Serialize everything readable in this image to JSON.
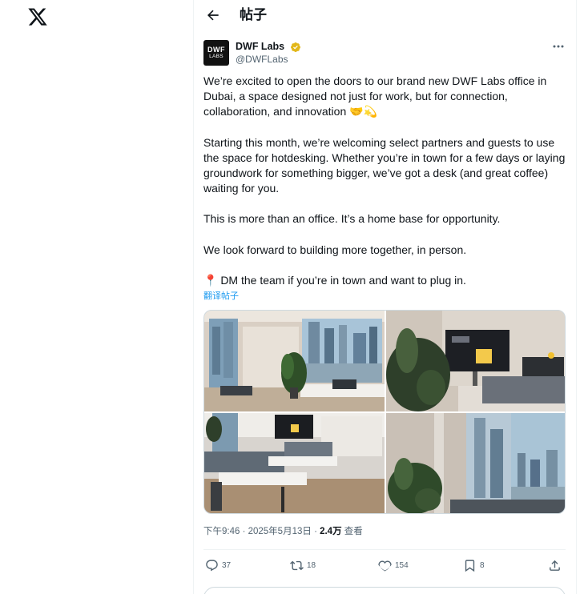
{
  "header": {
    "title": "帖子"
  },
  "author": {
    "avatar_line1": "DWF",
    "avatar_line2": "LABS",
    "display_name": "DWF Labs",
    "handle": "@DWFLabs"
  },
  "tweet": {
    "p1_l1": "We’re excited to open the doors to our brand new DWF Labs office in",
    "p1_l2": "Dubai, a space designed not just for work, but for connection,",
    "p1_l3": "collaboration, and innovation 🤝💫",
    "p2_l1": "Starting this month, we’re welcoming select partners and guests to use",
    "p2_l2": "the space for hotdesking. Whether you’re in town for a few days or laying",
    "p2_l3": "groundwork for something bigger, we’ve got a desk (and great coffee)",
    "p2_l4": "waiting for you.",
    "p3": "This is more than an office. It’s a home base for opportunity.",
    "p4": "We look forward to building more together, in person.",
    "p5": "📍 DM the team if you’re in town and want to plug in.",
    "translate": "翻译帖子"
  },
  "meta": {
    "time": "下午9:46 · 2025年5月13日 · ",
    "views": "2.4万",
    "views_label": " 查看"
  },
  "actions": {
    "replies": "37",
    "reposts": "18",
    "likes": "154",
    "bookmarks": "8"
  },
  "colors": {
    "text": "#0f1419",
    "secondary": "#536471",
    "accent": "#1d9bf0",
    "verified": "#e2b719",
    "border": "#eff3f4"
  },
  "icons": [
    "x-logo-icon",
    "back-arrow-icon",
    "verified-badge-icon",
    "more-icon",
    "reply-icon",
    "repost-icon",
    "like-icon",
    "bookmark-icon",
    "share-icon"
  ]
}
